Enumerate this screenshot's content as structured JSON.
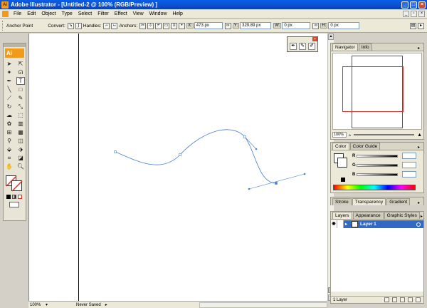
{
  "window": {
    "title": "Adobe Illustrator - [Untitled-2 @ 100% (RGB/Preview) ]",
    "app_icon": "Ai"
  },
  "menu": [
    "File",
    "Edit",
    "Object",
    "Type",
    "Select",
    "Filter",
    "Effect",
    "View",
    "Window",
    "Help"
  ],
  "control": {
    "anchor_point_label": "Anchor Point",
    "convert_label": "Convert:",
    "handles_label": "Handles:",
    "anchors_label": "Anchors:",
    "x_label": "X:",
    "x_value": "473 px",
    "y_label": "Y:",
    "y_value": "329.89 px",
    "w_label": "W:",
    "w_value": "0 px",
    "h_label": "H:",
    "h_value": "0 px"
  },
  "toolbox": {
    "logo": "Ai"
  },
  "status": {
    "zoom": "100%",
    "save_state": "Never Saved"
  },
  "navigator": {
    "tabs": [
      "Navigator",
      "Info"
    ],
    "zoom": "100%"
  },
  "color": {
    "tabs": [
      "Color",
      "Color Guide"
    ],
    "channels": [
      "R",
      "G",
      "B"
    ]
  },
  "transparency": {
    "tabs": [
      "Stroke",
      "Transparency",
      "Gradient"
    ]
  },
  "layers": {
    "tabs": [
      "Layers",
      "Appearance",
      "Graphic Styles"
    ],
    "items": [
      {
        "name": "Layer 1"
      }
    ],
    "count_label": "1 Layer"
  },
  "colors": {
    "selection_blue": "#4a7fd6",
    "accent_orange": "#f29b19",
    "nav_red": "#e0302a"
  }
}
